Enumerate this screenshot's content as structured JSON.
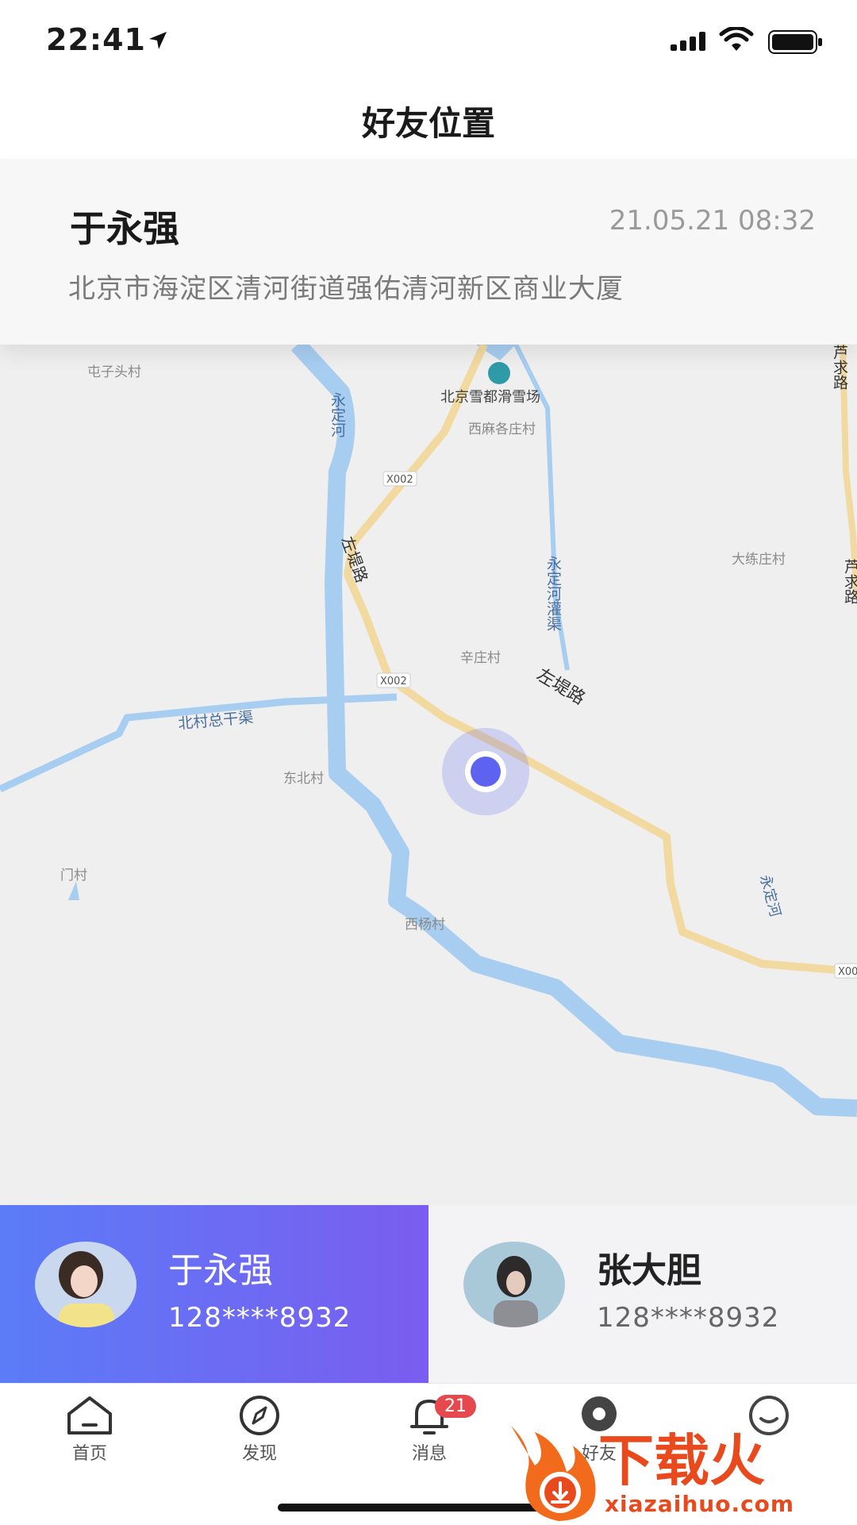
{
  "status_bar": {
    "time": "22:41"
  },
  "header": {
    "title": "好友位置"
  },
  "info_card": {
    "name": "于永强",
    "timestamp": "21.05.21 08:32",
    "address": "北京市海淀区清河街道强佑清河新区商业大厦"
  },
  "map": {
    "labels": {
      "tunzitou": "屯子头村",
      "ski": "北京雪都滑雪场",
      "ximage": "西麻各庄村",
      "x002a": "X002",
      "x002b": "X002",
      "x002c": "X00",
      "xinzhuang": "辛庄村",
      "dalian": "大练庄村",
      "dongbei": "东北村",
      "men": "门村",
      "xiyang": "西杨村",
      "beicun": "北村总干渠",
      "zuodi1": "左堤路",
      "zuodi2": "左堤路",
      "yongding1": "永定河",
      "yongding2": "永定河",
      "guanqu": "永定河灌渠",
      "luqiu1": "芦求路",
      "luqiu2": "芦求路"
    }
  },
  "friends": [
    {
      "name": "于永强",
      "phone": "128****8932",
      "active": true
    },
    {
      "name": "张大胆",
      "phone": "128****8932",
      "active": false
    }
  ],
  "tabs": [
    {
      "label": "首页"
    },
    {
      "label": "发现"
    },
    {
      "label": "消息",
      "badge": "21"
    },
    {
      "label": "好友"
    },
    {
      "label": ""
    }
  ],
  "watermark": {
    "brand": "下载火",
    "url": "xiazaihuo.com"
  },
  "colors": {
    "accent_start": "#5b7cf7",
    "accent_end": "#7a5df0",
    "badge": "#e5484d",
    "marker": "#5d63f0"
  }
}
